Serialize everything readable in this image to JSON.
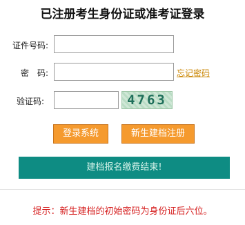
{
  "title": "已注册考生身份证或准考证登录",
  "form": {
    "id_label": "证件号码:",
    "id_value": "",
    "password_label": "密　码:",
    "password_value": "",
    "forgot_password": "忘记密码",
    "captcha_label": "验证码:",
    "captcha_value": "",
    "captcha_code": "4763"
  },
  "buttons": {
    "login": "登录系统",
    "register": "新生建档注册",
    "closed_notice": "建档报名缴费结束!"
  },
  "tip": "提示：新生建档的初始密码为身份证后六位。",
  "colors": {
    "button_orange": "#f59a2e",
    "notice_teal": "#0e8c83",
    "tip_red": "#d61f1f",
    "link_orange": "#c98500"
  }
}
